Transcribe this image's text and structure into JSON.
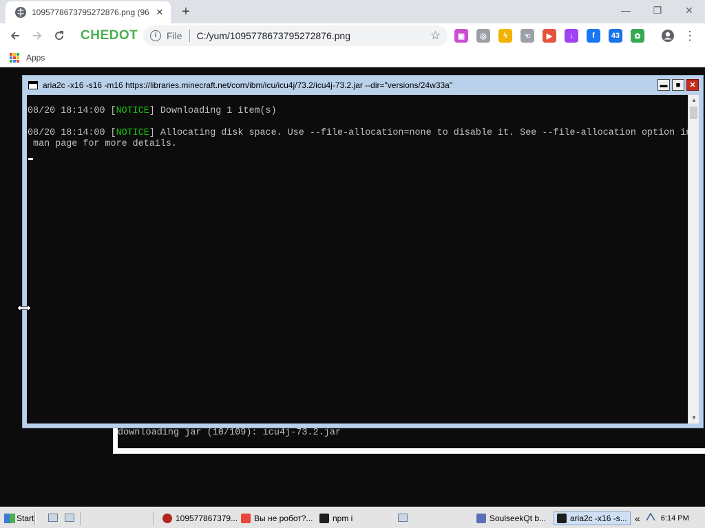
{
  "browser": {
    "tab": {
      "title": "1095778673795272876.png (96",
      "close": "✕"
    },
    "new_tab": "+",
    "window_controls": {
      "minimize": "—",
      "restore": "❐",
      "close": "✕"
    },
    "brand": "CHEDOT",
    "address": {
      "scheme": "File",
      "url": "C:/yum/1095778673795272876.png"
    },
    "extensions": [
      {
        "icon": "tv-extension-icon",
        "color": "#c94fd0",
        "text": "▣"
      },
      {
        "icon": "whatsapp-icon",
        "color": "#9aa0a6",
        "text": "◎"
      },
      {
        "icon": "messenger-icon",
        "color": "#f0b400",
        "text": "ϟ"
      },
      {
        "icon": "hand-icon",
        "color": "#9aa0a6",
        "text": "☜"
      },
      {
        "icon": "video-icon",
        "color": "#e5533d",
        "text": "▶"
      },
      {
        "icon": "download-icon",
        "color": "#a142f4",
        "text": "↓"
      },
      {
        "icon": "facebook-icon",
        "color": "#1877f2",
        "text": "f"
      },
      {
        "icon": "counter-icon",
        "color": "#1a73e8",
        "text": "43"
      },
      {
        "icon": "gear-ext-icon",
        "color": "#34a853",
        "text": "✿"
      }
    ],
    "bookmarks": {
      "apps_label": "Apps"
    }
  },
  "console_back": {
    "line": "downloading jar (10/109): icu4j-73.2.jar"
  },
  "console": {
    "title": "aria2c  -x16 -s16 -m16 https://libraries.minecraft.net/com/ibm/icu/icu4j/73.2/icu4j-73.2.jar --dir=\"versions/24w33a\"",
    "buttons": {
      "minimize": "▬",
      "maximize": "■",
      "close": "✕"
    },
    "lines": [
      {
        "prefix": "08/20 18:14:00 [",
        "tag": "NOTICE",
        "text": "] Downloading 1 item(s)"
      },
      {
        "prefix": "08/20 18:14:00 [",
        "tag": "NOTICE",
        "text": "] Allocating disk space. Use --file-allocation=none to disable it. See --file-allocation option in"
      },
      {
        "prefix": "",
        "tag": "",
        "text": " man page for more details."
      }
    ],
    "scroll": {
      "up": "▲",
      "down": "▼"
    }
  },
  "taskbar": {
    "start": "Start",
    "items": [
      {
        "label": "109577867379...",
        "color": "#b3261e"
      },
      {
        "label": "Вы не робот?...",
        "color": "#e8453c"
      },
      {
        "label": "npm i",
        "color": "#1e1e1e"
      },
      {
        "label": "SoulseekQt b...",
        "color": "#5b6fb8"
      },
      {
        "label": "aria2c  -x16 -s...",
        "color": "#1e1e1e"
      }
    ],
    "tray_chevron": "«",
    "clock": "6:14 PM"
  }
}
